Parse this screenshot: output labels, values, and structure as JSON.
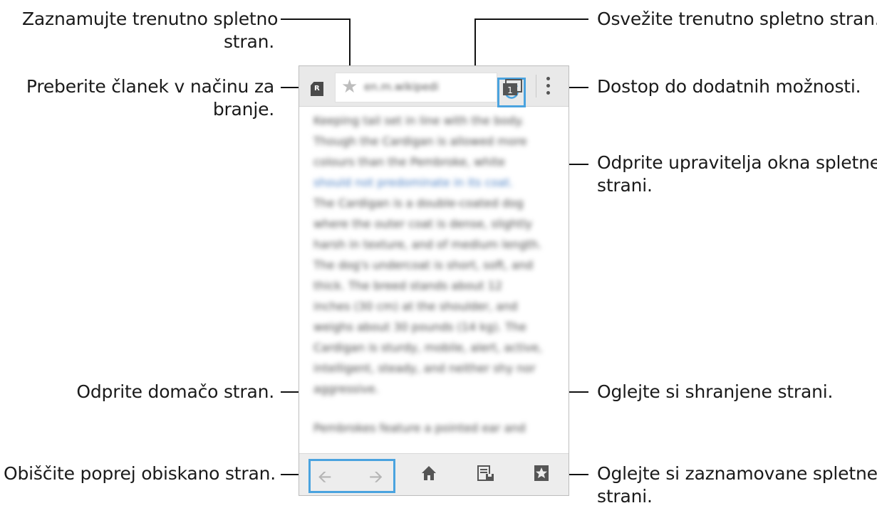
{
  "callouts": {
    "bookmark_current": [
      "Zaznamujte trenutno spletno",
      "stran."
    ],
    "refresh": [
      "Osvežite trenutno spletno stran."
    ],
    "reader_mode": [
      "Preberite članek v načinu za",
      "branje."
    ],
    "more_options": [
      "Dostop do dodatnih možnosti."
    ],
    "tab_manager": [
      "Odprite upravitelja okna spletne",
      "strani."
    ],
    "home": [
      "Odprite domačo stran."
    ],
    "saved_pages": [
      "Oglejte si shranjene strani."
    ],
    "back_forward": [
      "Obiščite poprej obiskano stran."
    ],
    "bookmarks": [
      "Oglejte si zaznamovane spletne",
      "strani."
    ]
  },
  "browser": {
    "url": "en.m.wikipedi",
    "reader_label": "R",
    "tab_count": "1",
    "article_lines": [
      "Keeping tail set in line with the body.",
      "Though the Cardigan is allowed more",
      "colours than the Pembroke, white",
      "should not predominate in its coat.",
      "The Cardigan is a double-coated dog",
      "where the outer coat is dense, slightly",
      "harsh in texture, and of medium length.",
      "The dog's undercoat is short, soft, and",
      "thick. The breed stands about 12",
      "inches (30 cm) at the shoulder, and",
      "weighs about 30 pounds (14 kg). The",
      "Cardigan is sturdy, mobile, alert, active,",
      "intelligent, steady, and neither shy nor",
      "aggressive."
    ],
    "article_tail": "Pembrokes feature a pointed ear and"
  },
  "icons": {
    "reader": "reader-icon",
    "star": "star-icon",
    "refresh": "refresh-icon",
    "tabs": "tabs-icon",
    "more": "more-icon",
    "back": "back-arrow-icon",
    "forward": "forward-arrow-icon",
    "home": "home-icon",
    "saved": "saved-pages-icon",
    "bookmarks": "bookmarks-icon"
  },
  "colors": {
    "highlight": "#4aa3df",
    "icon": "#555555",
    "disabled": "#b5b5b5"
  }
}
